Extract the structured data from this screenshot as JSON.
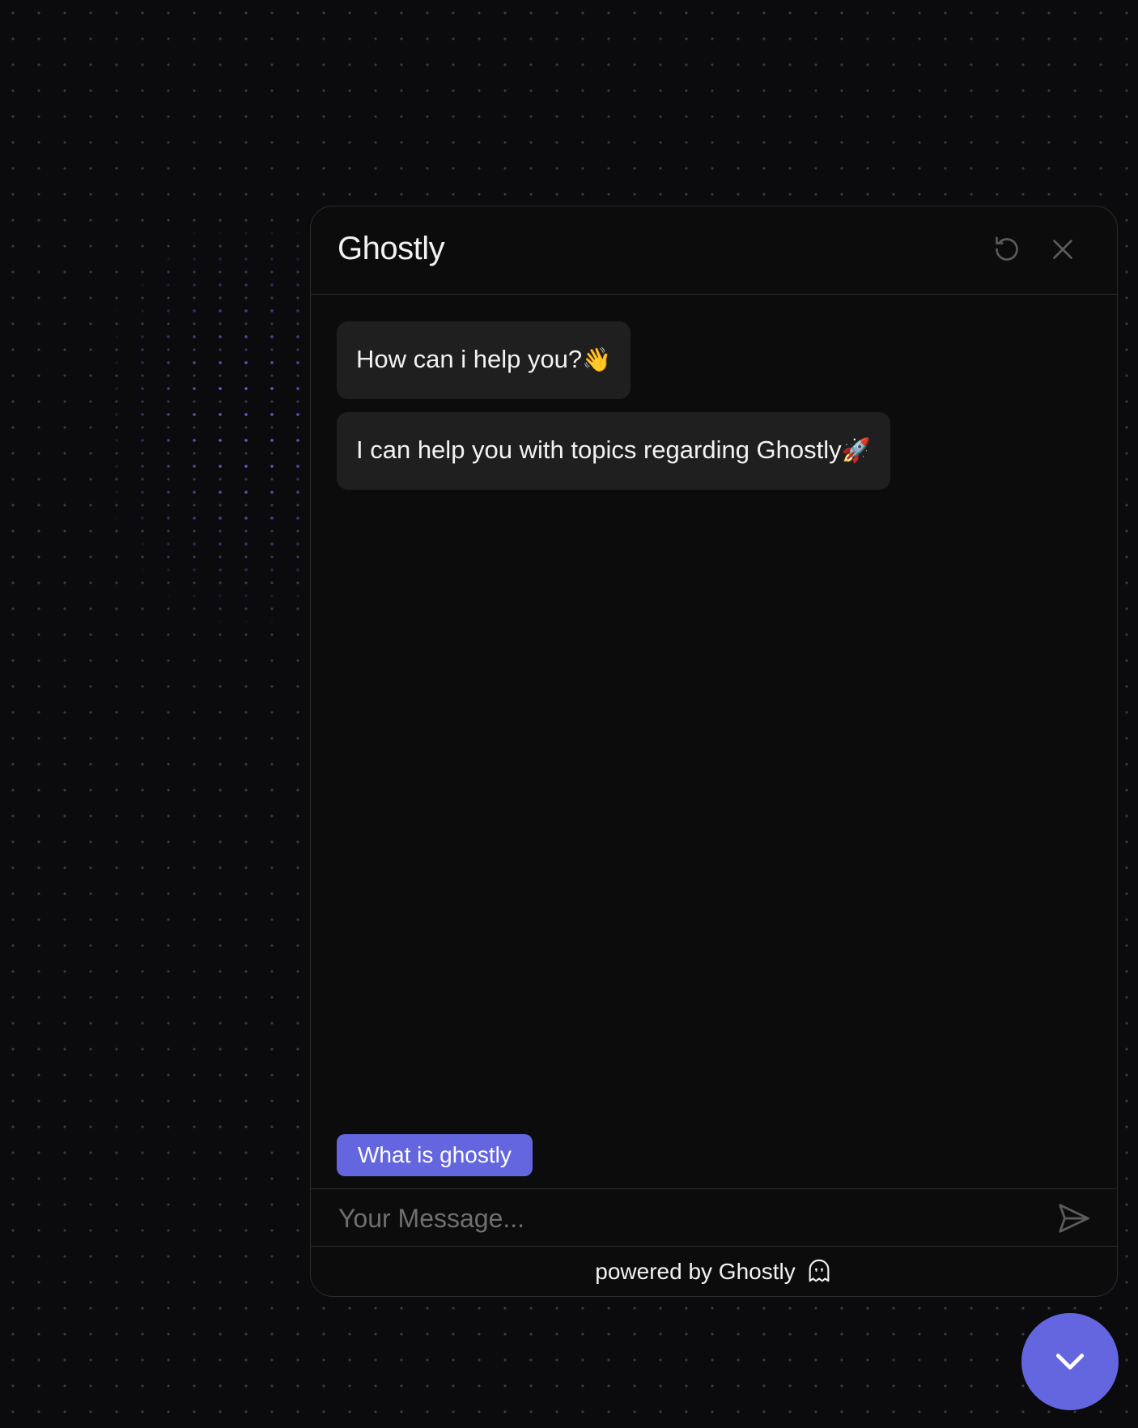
{
  "chat": {
    "title": "Ghostly",
    "messages": [
      {
        "text": "How can i help you?",
        "emoji": "👋"
      },
      {
        "text": "I can help you with topics regarding Ghostly",
        "emoji": "🚀"
      }
    ],
    "suggestion": "What is ghostly",
    "input": {
      "placeholder": "Your Message...",
      "value": ""
    },
    "footer": {
      "text": "powered by Ghostly"
    }
  },
  "icons": {
    "reset": "refresh-icon",
    "close": "close-icon",
    "send": "send-icon",
    "ghost": "ghost-icon",
    "fab": "chevron-down-icon"
  },
  "colors": {
    "accent": "#6466e0",
    "bubble": "#1f1f1f",
    "panel": "#0c0c0c",
    "background": "#0b0b0e"
  }
}
